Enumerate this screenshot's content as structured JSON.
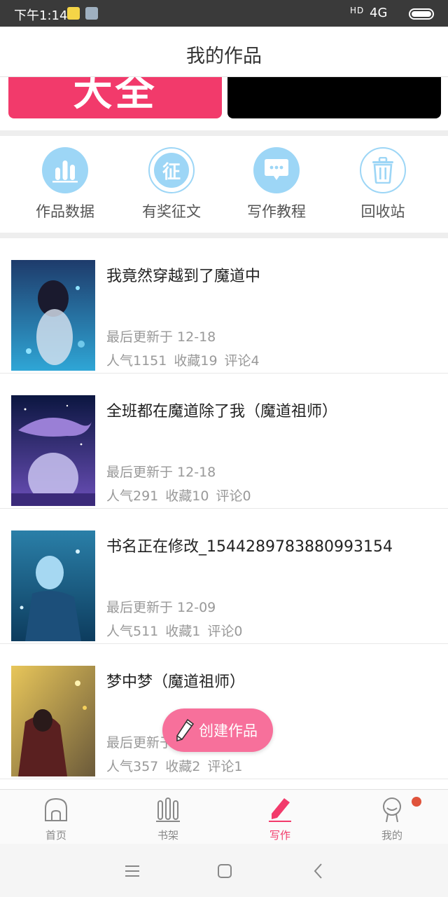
{
  "status_bar": {
    "time": "下午1:14",
    "signal_label": "HD",
    "network": "4G"
  },
  "header": {
    "title": "我的作品"
  },
  "banner": {
    "left_text": "大全"
  },
  "actions": [
    {
      "label": "作品数据",
      "icon": "bar-chart-icon",
      "color": "#9dd6f6"
    },
    {
      "label": "有奖征文",
      "icon": "contest-icon",
      "glyph": "征",
      "color": "#9dd6f6"
    },
    {
      "label": "写作教程",
      "icon": "chat-bubble-icon",
      "color": "#9dd6f6"
    },
    {
      "label": "回收站",
      "icon": "trash-icon",
      "color": "#9dd6f6"
    }
  ],
  "works": [
    {
      "title": "我竟然穿越到了魔道中",
      "updated": "最后更新于 12-18",
      "popularity": "人气1151",
      "favorites": "收藏19",
      "comments": "评论4"
    },
    {
      "title": "全班都在魔道除了我（魔道祖师）",
      "updated": "最后更新于 12-18",
      "popularity": "人气291",
      "favorites": "收藏10",
      "comments": "评论0"
    },
    {
      "title": "书名正在修改_1544289783880993154",
      "updated": "最后更新于 12-09",
      "popularity": "人气511",
      "favorites": "收藏1",
      "comments": "评论0"
    },
    {
      "title": "梦中梦（魔道祖师）",
      "updated": "最后更新于 12-09",
      "popularity": "人气357",
      "favorites": "收藏2",
      "comments": "评论1"
    }
  ],
  "fab": {
    "label": "创建作品"
  },
  "tabs": [
    {
      "label": "首页",
      "icon": "home-icon"
    },
    {
      "label": "书架",
      "icon": "bookshelf-icon"
    },
    {
      "label": "写作",
      "icon": "pencil-icon",
      "active": true
    },
    {
      "label": "我的",
      "icon": "profile-icon"
    }
  ],
  "colors": {
    "accent": "#f23a6b",
    "icon_blue": "#9dd6f6",
    "fab": "#f7709b"
  }
}
